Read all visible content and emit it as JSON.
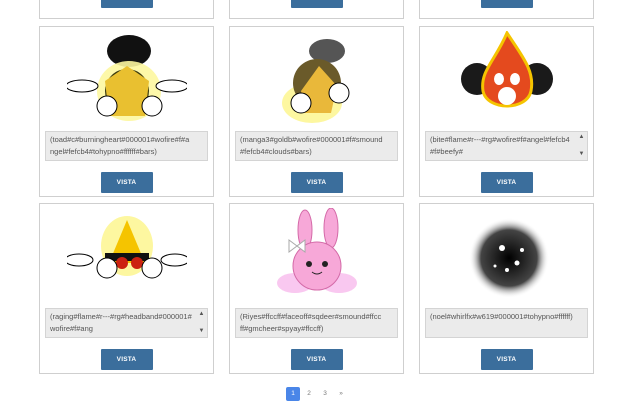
{
  "button_label": "VISTA",
  "cards": [
    {
      "code": "(toad#c#burningheart#000001#wofire#f#angel#fefcb4#tohypno#ffffff#bars)",
      "scroll": false
    },
    {
      "code": "(manga3#goldb#wofire#000001#f#smound#fefcb4#clouds#bars)",
      "scroll": false
    },
    {
      "code": "(bite#flame#r---#rg#wofire#f#angel#fefcb4#f#beefy#",
      "scroll": true
    },
    {
      "code": "(raging#flame#r---#rg#headband#000001#wofire#f#ang",
      "scroll": true
    },
    {
      "code": "(Riyes#ffccff#faceoff#sqdeer#smound#ffccff#gmcheer#spyay#ffccff)",
      "scroll": false
    },
    {
      "code": "(noel#whirlfx#w619#000001#tohypno#ffffff)",
      "scroll": false
    }
  ],
  "scroll_up": "▲",
  "scroll_down": "▼",
  "pagination": [
    "1",
    "2",
    "3",
    "»"
  ],
  "colors": {
    "button": "#3b6e9c",
    "active_page": "#4a86e8",
    "code_bg": "#ebebeb"
  }
}
